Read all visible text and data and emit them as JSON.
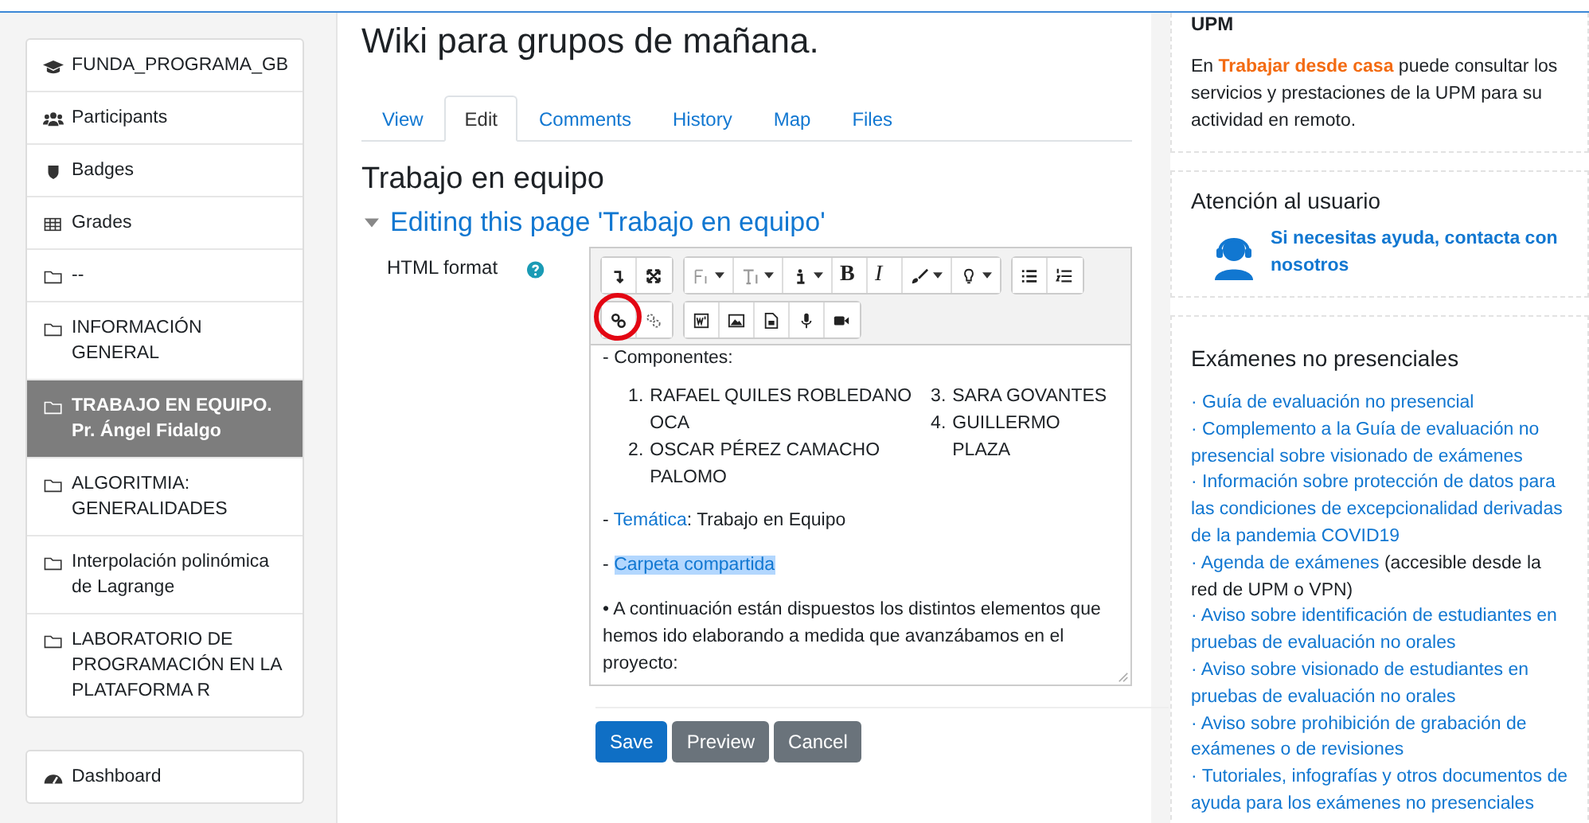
{
  "sidebar": {
    "items": [
      {
        "label": "FUNDA_PROGRAMA_GB",
        "selected": false
      },
      {
        "label": "Participants",
        "selected": false
      },
      {
        "label": "Badges",
        "selected": false
      },
      {
        "label": "Grades",
        "selected": false
      },
      {
        "label": "--",
        "selected": false
      },
      {
        "label": "INFORMACIÓN GENERAL",
        "selected": false
      },
      {
        "label": "TRABAJO EN EQUIPO. Pr. Ángel Fidalgo",
        "selected": true
      },
      {
        "label": "ALGORITMIA: GENERALIDADES",
        "selected": false
      },
      {
        "label": "Interpolación polinómica de Lagrange",
        "selected": false
      },
      {
        "label": "LABORATORIO DE PROGRAMACIÓN EN LA PLATAFORMA R",
        "selected": false
      }
    ],
    "dashboard": "Dashboard"
  },
  "page": {
    "title": "Wiki para grupos de mañana.",
    "tabs": [
      {
        "label": "View",
        "selected": false
      },
      {
        "label": "Edit",
        "selected": true
      },
      {
        "label": "Comments",
        "selected": false
      },
      {
        "label": "History",
        "selected": false
      },
      {
        "label": "Map",
        "selected": false
      },
      {
        "label": "Files",
        "selected": false
      }
    ],
    "heading": "Trabajo en equipo",
    "section": "Editing this page 'Trabajo en equipo'",
    "section_expanded": true,
    "field_label": "HTML format",
    "toolbar": [
      [
        [
          {
            "kind": "toggle"
          },
          {
            "kind": "fullscreen"
          }
        ],
        [
          {
            "kind": "font",
            "dropdown": true
          },
          {
            "kind": "textsize",
            "dropdown": true
          },
          {
            "kind": "style",
            "dropdown": true
          },
          {
            "kind": "bold",
            "label": "B"
          },
          {
            "kind": "italic",
            "label": "I"
          },
          {
            "kind": "color",
            "dropdown": true
          },
          {
            "kind": "lightbulb",
            "dropdown": true
          }
        ],
        [
          {
            "kind": "bullets"
          },
          {
            "kind": "numbers"
          }
        ]
      ],
      [
        [
          {
            "kind": "link",
            "highlighted": true
          },
          {
            "kind": "unlink"
          }
        ],
        [
          {
            "kind": "word"
          },
          {
            "kind": "image"
          },
          {
            "kind": "media"
          },
          {
            "kind": "audio"
          },
          {
            "kind": "video"
          }
        ]
      ]
    ],
    "content": {
      "intro": "- Componentes:",
      "members": [
        [
          {
            "number": "1.",
            "name": "RAFAEL QUILES ROBLEDANO OCA"
          },
          {
            "number": "2.",
            "name": "OSCAR PÉREZ CAMACHO PALOMO"
          }
        ],
        [
          {
            "number": "3.",
            "name": "SARA GOVANTES"
          },
          {
            "number": "4.",
            "name": "GUILLERMO PLAZA"
          }
        ]
      ],
      "topic": {
        "prefix": "- ",
        "link": "Temática",
        "suffix": ": Trabajo en Equipo"
      },
      "folder": {
        "prefix": "- ",
        "link": "Carpeta compartida",
        "highlighted": true
      },
      "paragraph": "• A continuación están dispuestos los distintos elementos que hemos ido elaborando a medida que avanzábamos en el proyecto:"
    },
    "buttons": [
      {
        "label": "Save",
        "kind": "primary"
      },
      {
        "label": "Preview",
        "kind": "secondary"
      },
      {
        "label": "Cancel",
        "kind": "secondary"
      }
    ]
  },
  "right": {
    "upm_heading": "UPM",
    "upm_text": "En **Trabajar desde casa** puede consultar los servicios y prestaciones de la UPM para su actividad en remoto.",
    "support_heading": "Atención al usuario",
    "support_link": "Si necesitas ayuda, contacta con nosotros",
    "exams_heading": "Exámenes no presenciales",
    "exams": [
      {
        "link": "· Guía de evaluación no presencial"
      },
      {
        "link": "· Complemento a la Guía de evaluación no presencial sobre visionado de exámenes"
      },
      {
        "link": "· Información sobre protección de datos para las condiciones de excepcionalidad derivadas de la pandemia COVID19"
      },
      {
        "link": "· Agenda de exámenes",
        "note": " (accesible desde la red de UPM o VPN)"
      },
      {
        "link": "· Aviso sobre identificación de estudiantes en pruebas de evaluación no orales"
      },
      {
        "link": "· Aviso sobre visionado de estudiantes en pruebas de evaluación no orales"
      },
      {
        "link": "· Aviso sobre prohibición de grabación de exámenes o de revisiones"
      },
      {
        "link": "· Tutoriales, infografías y otros documentos de ayuda para los exámenes no presenciales"
      }
    ]
  }
}
